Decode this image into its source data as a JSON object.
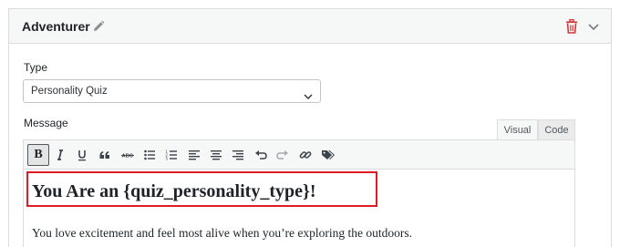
{
  "panel": {
    "title": "Adventurer",
    "icons": {
      "edit": "pencil-icon",
      "delete": "trash-icon",
      "toggle": "chevron-down-icon"
    },
    "delete_color": "#d63638"
  },
  "type_field": {
    "label": "Type",
    "selected": "Personality Quiz"
  },
  "message_field": {
    "label": "Message",
    "tabs": [
      {
        "label": "Visual",
        "active": true
      },
      {
        "label": "Code",
        "active": false
      }
    ],
    "toolbar": {
      "bold_label": "B",
      "buttons": [
        "bold",
        "italic",
        "underline",
        "blockquote",
        "strikethrough",
        "bullet-list",
        "numbered-list",
        "align-left",
        "align-center",
        "align-right",
        "undo",
        "redo",
        "link",
        "tag"
      ]
    },
    "content": {
      "heading": "You Are an {quiz_personality_type}!",
      "paragraph": "You love excitement and feel most alive when you’re exploring the outdoors."
    }
  },
  "colors": {
    "highlight": "#e01b24",
    "header_bg": "#f6f7f7",
    "border": "#dcdcde"
  }
}
